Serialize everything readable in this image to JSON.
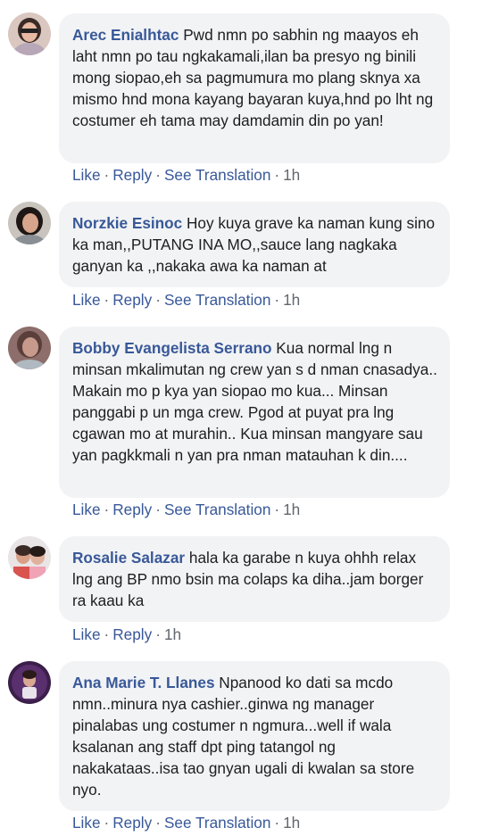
{
  "actions": {
    "like": "Like",
    "reply": "Reply",
    "see_translation": "See Translation",
    "separator": "·"
  },
  "comments": [
    {
      "author": "Arec Enialhtac",
      "text": "Pwd nmn po sabhin ng maayos eh laht nmn po tau ngkakamali,ilan ba presyo ng binili mong siopao,eh sa pagmumura mo plang sknya xa mismo hnd mona kayang bayaran kuya,hnd po lht ng costumer eh tama may damdamin din po yan!",
      "time": "1h",
      "translation": true
    },
    {
      "author": "Norzkie Esinoc",
      "text": "Hoy kuya grave ka naman kung sino ka man,,PUTANG INA MO,,sauce lang nagkaka ganyan ka ,,nakaka awa ka naman at",
      "time": "1h",
      "translation": true
    },
    {
      "author": "Bobby Evangelista Serrano",
      "text": "Kua normal lng n minsan mkalimutan ng crew yan s d nman cnasadya.. Makain mo p kya yan siopao mo kua... Minsan panggabi p un mga crew. Pgod at puyat pra lng cgawan mo at murahin.. Kua minsan mangyare sau yan pagkkmali n yan pra nman matauhan k din....",
      "time": "1h",
      "translation": true
    },
    {
      "author": "Rosalie Salazar",
      "text": "hala ka garabe n kuya ohhh relax lng ang BP nmo bsin ma colaps ka diha..jam borger ra kaau ka",
      "time": "1h",
      "translation": false
    },
    {
      "author": "Ana Marie T. Llanes",
      "text": "Npanood ko dati sa mcdo nmn..minura nya cashier..ginwa ng manager pinalabas ung costumer n ngmura...well if wala ksalanan ang staff dpt ping tatangol ng nakakataas..isa tao gnyan ugali di kwalan sa store nyo.",
      "time": "1h",
      "translation": true
    }
  ]
}
